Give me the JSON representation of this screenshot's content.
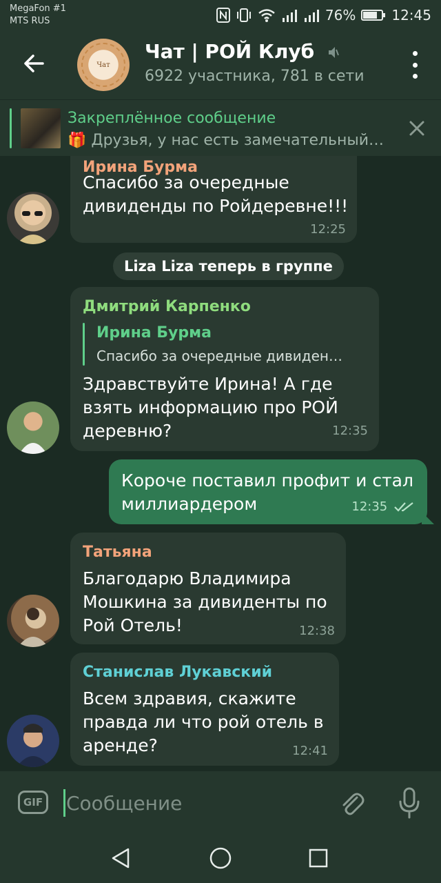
{
  "status_bar": {
    "carrier_1": "MegaFon #1",
    "carrier_2": "MTS RUS",
    "battery": "76%",
    "battery_level": 0.76,
    "time": "12:45"
  },
  "header": {
    "title": "Чат | РОЙ Клуб",
    "subtitle": "6922 участника, 781 в сети",
    "avatar_text": "Чат"
  },
  "pinned": {
    "title": "Закреплённое сообщение",
    "emoji": "🎁",
    "text": "Друзья, у нас есть замечательный…"
  },
  "messages": [
    {
      "sender": "Ирина Бурма",
      "text_lines": [
        "Спасибо за очередные",
        "дивиденды по Ройдеревне!!!"
      ],
      "time": "12:25"
    },
    {
      "service": "Liza Liza теперь в группе"
    },
    {
      "sender": "Дмитрий Карпенко",
      "reply_name": "Ирина Бурма",
      "reply_text": "Спасибо за очередные дивиден…",
      "text_lines": [
        "Здравствуйте Ирина! А где",
        "взять информацию про РОЙ",
        "деревню?"
      ],
      "time": "12:35"
    },
    {
      "outgoing": true,
      "text_lines": [
        "Короче поставил профит и стал",
        "миллиардером"
      ],
      "time": "12:35"
    },
    {
      "sender": "Татьяна",
      "text_lines": [
        "Благодарю Владимира",
        "Мошкина за дивиденты по",
        "Рой Отель!"
      ],
      "time": "12:38"
    },
    {
      "sender": "Станислав Лукавский",
      "text_lines": [
        "Всем здравия, скажите",
        "правда ли что рой отель в",
        "аренде?"
      ],
      "time": "12:41"
    }
  ],
  "input": {
    "gif_label": "GIF",
    "placeholder": "Сообщение"
  },
  "colors": {
    "accent": "#5fcf8a",
    "sender_irina": "#f2a37a",
    "sender_dmitry": "#8fdc7e",
    "sender_tatyana": "#f2a37a",
    "sender_stanislav": "#5fd0d5"
  }
}
